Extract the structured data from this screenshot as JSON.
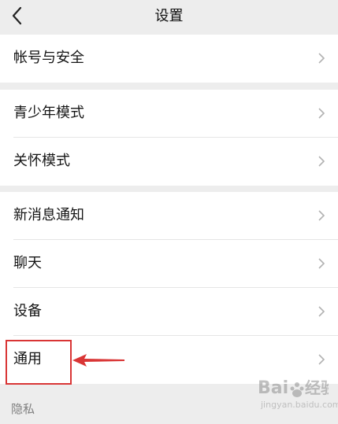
{
  "header": {
    "title": "设置",
    "back_icon": "chevron-left-icon"
  },
  "groups": [
    {
      "items": [
        {
          "label": "帐号与安全"
        }
      ]
    },
    {
      "items": [
        {
          "label": "青少年模式"
        },
        {
          "label": "关怀模式"
        }
      ]
    },
    {
      "items": [
        {
          "label": "新消息通知"
        },
        {
          "label": "聊天"
        },
        {
          "label": "设备"
        },
        {
          "label": "通用"
        }
      ]
    }
  ],
  "section_label": "隐私",
  "annotation": {
    "highlight_color": "#d93535",
    "highlighted_item": "通用"
  },
  "watermark": {
    "brand": "Bai百度",
    "sub": "jingyan.baidu.com"
  }
}
